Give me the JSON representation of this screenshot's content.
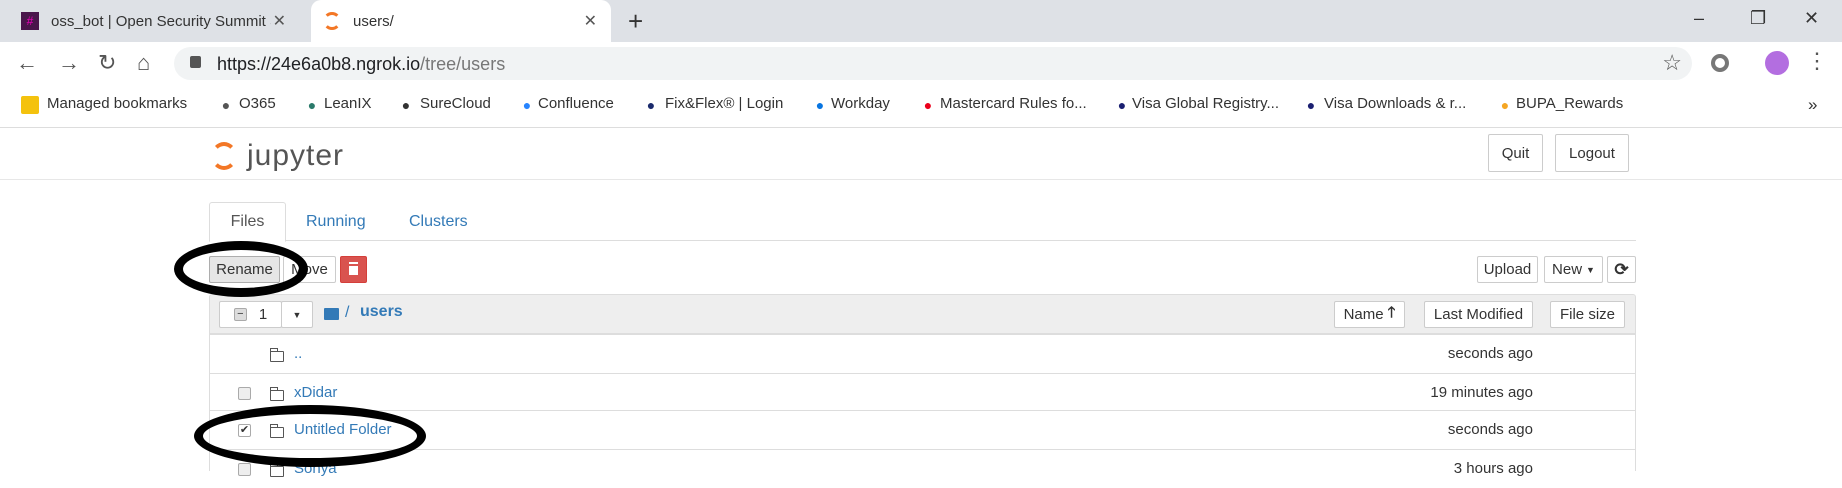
{
  "browser": {
    "tabs": [
      {
        "title": "oss_bot | Open Security Summit S",
        "icon": "slack-icon",
        "close": "✕"
      },
      {
        "title": "users/",
        "icon": "jupyter-icon",
        "close": "✕"
      }
    ],
    "new_tab": "+",
    "window_controls": {
      "minimize": "–",
      "restore": "❐",
      "close": "✕"
    },
    "url_host": "https://24e6a0b8.ngrok.io",
    "url_path": "/tree/users",
    "bookmarks": [
      {
        "label": "Managed bookmarks",
        "icon": "folder-icon",
        "color": "#f4c20d"
      },
      {
        "label": "O365",
        "icon": "globe-icon",
        "color": "#555555"
      },
      {
        "label": "LeanIX",
        "icon": "leanix-icon",
        "color": "#2a7a6a"
      },
      {
        "label": "SureCloud",
        "icon": "cloud-icon",
        "color": "#333333"
      },
      {
        "label": "Confluence",
        "icon": "confluence-icon",
        "color": "#2684ff"
      },
      {
        "label": "Fix&Flex® | Login",
        "icon": "fixflex-icon",
        "color": "#1a2a6c"
      },
      {
        "label": "Workday",
        "icon": "workday-icon",
        "color": "#0875e1"
      },
      {
        "label": "Mastercard Rules fo...",
        "icon": "mastercard-icon",
        "color": "#eb001b"
      },
      {
        "label": "Visa Global Registry...",
        "icon": "visa-v-icon",
        "color": "#1a1f71"
      },
      {
        "label": "Visa Downloads & r...",
        "icon": "visa-icon",
        "color": "#1a1f71"
      },
      {
        "label": "BUPA_Rewards",
        "icon": "bupa-icon",
        "color": "#f5a623"
      }
    ],
    "more": "»"
  },
  "jupyter": {
    "logo": "jupyter",
    "quit": "Quit",
    "logout": "Logout",
    "tabs": [
      "Files",
      "Running",
      "Clusters"
    ],
    "toolbar": {
      "rename": "Rename",
      "move": "Move",
      "upload": "Upload",
      "new": "New"
    },
    "selected_count": "1",
    "breadcrumb": {
      "sep": "/",
      "folder": "users"
    },
    "columns": {
      "name": "Name",
      "last_modified": "Last Modified",
      "file_size": "File size"
    },
    "rows": [
      {
        "name": "..",
        "modified": "seconds ago",
        "checked": false,
        "checkbox": false
      },
      {
        "name": "xDidar",
        "modified": "19 minutes ago",
        "checked": false,
        "checkbox": true
      },
      {
        "name": "Untitled Folder",
        "modified": "seconds ago",
        "checked": true,
        "checkbox": true
      },
      {
        "name": "Sonya",
        "modified": "3 hours ago",
        "checked": false,
        "checkbox": true
      }
    ]
  }
}
